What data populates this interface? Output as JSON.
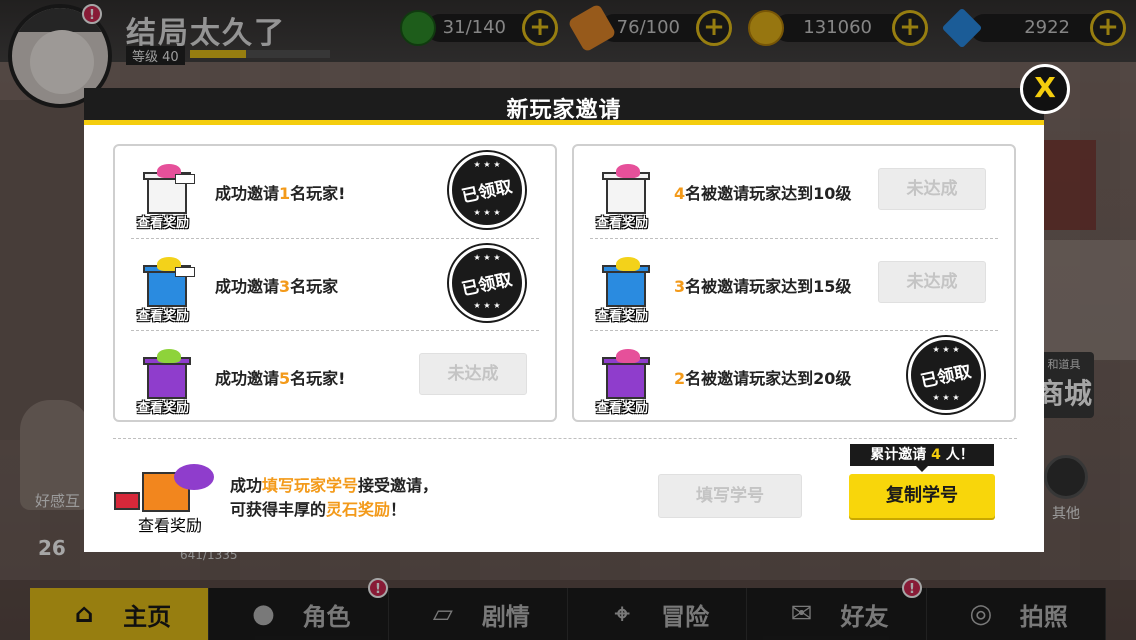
{
  "player": {
    "name": "结局太久了",
    "level_label": "等级 40",
    "badge": "!"
  },
  "resources": [
    {
      "name": "stamina",
      "icon": "leaf-icon",
      "value": "31/140",
      "color": "#2f8f2a"
    },
    {
      "name": "item",
      "icon": "bottle-icon",
      "value": "76/100",
      "color": "#e88a2a"
    },
    {
      "name": "gold",
      "icon": "coin-icon",
      "value": "131060",
      "color": "#e8b51a"
    },
    {
      "name": "diamond",
      "icon": "diamond-icon",
      "value": "2922",
      "color": "#2a8ee8"
    }
  ],
  "plus_label": "+",
  "background": {
    "fav_label": "好感互",
    "level_num": "26",
    "exp_text": "641/1335",
    "shop_small": "和道具",
    "shop_big": "商城",
    "other_label": "其他"
  },
  "dialog": {
    "title": "新玩家邀请",
    "close_label": "X",
    "view_reward": "查看奖励",
    "claimed_label": "已领取",
    "not_done_label": "未达成",
    "left_rows": [
      {
        "pre": "成功邀请",
        "num": "1",
        "post": "名玩家!",
        "status": "claimed",
        "gift_color": "#f4f4f4",
        "bow_color": "#e6509a"
      },
      {
        "pre": "成功邀请",
        "num": "3",
        "post": "名玩家",
        "status": "claimed",
        "gift_color": "#2a8be0",
        "bow_color": "#f3d21a"
      },
      {
        "pre": "成功邀请",
        "num": "5",
        "post": "名玩家!",
        "status": "not_done",
        "gift_color": "#8f3dcc",
        "bow_color": "#8ed33a"
      }
    ],
    "right_rows": [
      {
        "pre": "",
        "num": "4",
        "post": "名被邀请玩家达到10级",
        "status": "not_done",
        "gift_color": "#f4f4f4",
        "bow_color": "#e6509a"
      },
      {
        "pre": "",
        "num": "3",
        "post": "名被邀请玩家达到15级",
        "status": "not_done",
        "gift_color": "#2a8be0",
        "bow_color": "#f3d21a"
      },
      {
        "pre": "",
        "num": "2",
        "post": "名被邀请玩家达到20级",
        "status": "claimed",
        "gift_color": "#8f3dcc",
        "bow_color": "#e6509a"
      }
    ],
    "bottom_line1_pre": "成功",
    "bottom_line1_hl": "填写玩家学号",
    "bottom_line1_post": "接受邀请，",
    "bottom_line2_pre": "可获得丰厚的",
    "bottom_line2_hl": "灵石奖励",
    "bottom_line2_post": "！",
    "fill_button": "填写学号",
    "invite_count_pre": "累计邀请",
    "invite_count_num": "4",
    "invite_count_post": "人！",
    "copy_button": "复制学号"
  },
  "nav": [
    {
      "label": "主页",
      "icon": "home-icon",
      "active": true
    },
    {
      "label": "角色",
      "icon": "character-icon",
      "active": false,
      "badge": true
    },
    {
      "label": "剧情",
      "icon": "story-icon",
      "active": false
    },
    {
      "label": "冒险",
      "icon": "map-pin-icon",
      "active": false
    },
    {
      "label": "好友",
      "icon": "chat-icon",
      "active": false,
      "badge": true
    },
    {
      "label": "拍照",
      "icon": "camera-icon",
      "active": false
    }
  ],
  "colors": {
    "accent": "#f4cd0e",
    "highlight": "#f39a1a",
    "dark": "#1c1c1c"
  }
}
